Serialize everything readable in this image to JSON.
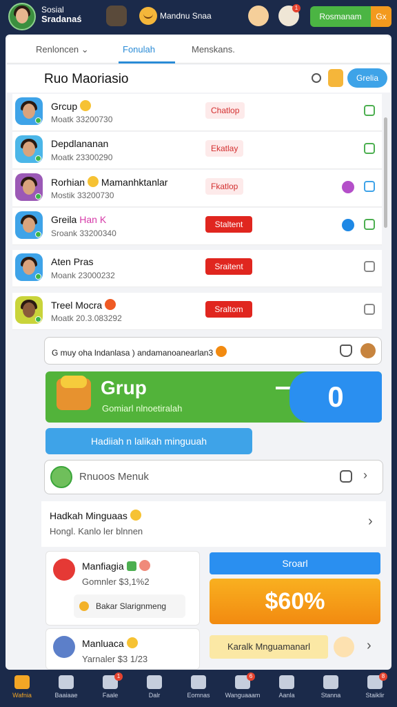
{
  "topbar": {
    "title_line1": "Sosial",
    "title_line2": "Sradanaś",
    "user_name": "Mandnu Snaa",
    "badge": "1",
    "action_label": "Rosmanam",
    "action_icon_label": "Gx"
  },
  "tabs": [
    {
      "label": "Renloncen ⌄"
    },
    {
      "label": "Fonulah"
    },
    {
      "label": "Menskans."
    }
  ],
  "section": {
    "title": "Ruo Maoriasio",
    "button_label": "Grelia"
  },
  "rows": [
    {
      "name": "Grcup",
      "sub": "Moatk 33200730",
      "tag": "Chatlop"
    },
    {
      "name": "Depdlananan",
      "sub": "Moatk 23300290",
      "tag": "Ekatlay"
    },
    {
      "name": "Rorhian",
      "name_extra": "Mamanhktanlar",
      "sub": "Mostik 33200730",
      "tag": "Fkatlop"
    },
    {
      "name": "Greila",
      "name_extra": "Han K",
      "sub": "Sroank 33200340",
      "tag": "Staltent"
    },
    {
      "name": "Aten Pras",
      "sub": "Moank 23000232",
      "tag": "Sraitent"
    },
    {
      "name": "Treel Mocra",
      "sub": "Moatk 20.3.083292",
      "tag": "Sraltom"
    }
  ],
  "comment": {
    "text": "G muy oha lndanlasa ) andamanoanearlan3"
  },
  "banner": {
    "title": "Grup",
    "subtitle": "Gomiarl nlnoetiralah",
    "count": "0"
  },
  "blue_bar_label": "Hadiiah n lalikah minguuah",
  "user_input": {
    "placeholder": "Rnuoos Menuk"
  },
  "info_row": {
    "title": "Hadkah Minguaas",
    "subtitle": "Hongl. Kanlo ler blnnen"
  },
  "cards": [
    {
      "name": "Manfiagia",
      "sub": "Gomnler $3,1%2",
      "chip": "Bakar Slarignmeng"
    },
    {
      "name": "Manluaca",
      "sub": "Yarnaler $3 1/23"
    }
  ],
  "right_button_label": "Sroarl",
  "promo_value": "$60%",
  "yellow_button_label": "Karalk Mnguamanarl",
  "bottom_nav": [
    {
      "label": "Wafnia",
      "badge": ""
    },
    {
      "label": "Baaiaae",
      "badge": ""
    },
    {
      "label": "Faale",
      "badge": "1"
    },
    {
      "label": "Dalr",
      "badge": ""
    },
    {
      "label": "Eomnas",
      "badge": ""
    },
    {
      "label": "Wanguaaam",
      "badge": "6"
    },
    {
      "label": "Aanla",
      "badge": ""
    },
    {
      "label": "Stanna",
      "badge": ""
    },
    {
      "label": "Staiklir",
      "badge": "8"
    }
  ],
  "colors": {
    "nav_bg": "#1b2a4a",
    "accent_blue": "#2a8bd6",
    "accent_green": "#4bb543",
    "accent_red": "#e0261f",
    "accent_orange": "#f39a1e"
  }
}
